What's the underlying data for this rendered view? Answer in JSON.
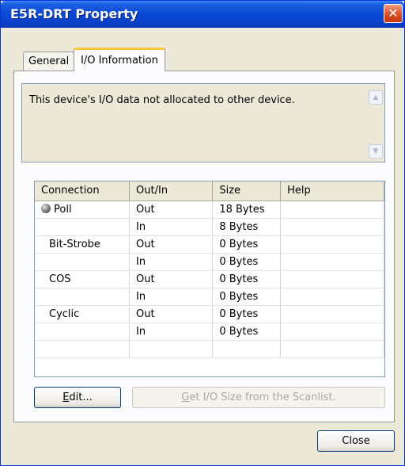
{
  "window": {
    "title": "E5R-DRT Property",
    "close_icon": "close-icon"
  },
  "tabs": [
    {
      "label": "General",
      "active": false
    },
    {
      "label": "I/O Information",
      "active": true
    }
  ],
  "message": "This device's I/O data not allocated to other device.",
  "table": {
    "columns": [
      "Connection",
      "Out/In",
      "Size",
      "Help"
    ],
    "rows": [
      {
        "connection": "Poll",
        "icon": "poll-icon",
        "direction": "Out",
        "size": "18 Bytes",
        "help": ""
      },
      {
        "connection": "",
        "direction": "In",
        "size": "8 Bytes",
        "help": ""
      },
      {
        "connection": "Bit-Strobe",
        "direction": "Out",
        "size": "0 Bytes",
        "help": ""
      },
      {
        "connection": "",
        "direction": "In",
        "size": "0 Bytes",
        "help": ""
      },
      {
        "connection": "COS",
        "direction": "Out",
        "size": "0 Bytes",
        "help": ""
      },
      {
        "connection": "",
        "direction": "In",
        "size": "0 Bytes",
        "help": ""
      },
      {
        "connection": "Cyclic",
        "direction": "Out",
        "size": "0 Bytes",
        "help": ""
      },
      {
        "connection": "",
        "direction": "In",
        "size": "0 Bytes",
        "help": ""
      }
    ]
  },
  "buttons": {
    "edit_prefix": "E",
    "edit_rest": "dit...",
    "get_size_prefix": "G",
    "get_size_rest": "et I/O Size from the Scanlist.",
    "close": "Close"
  }
}
